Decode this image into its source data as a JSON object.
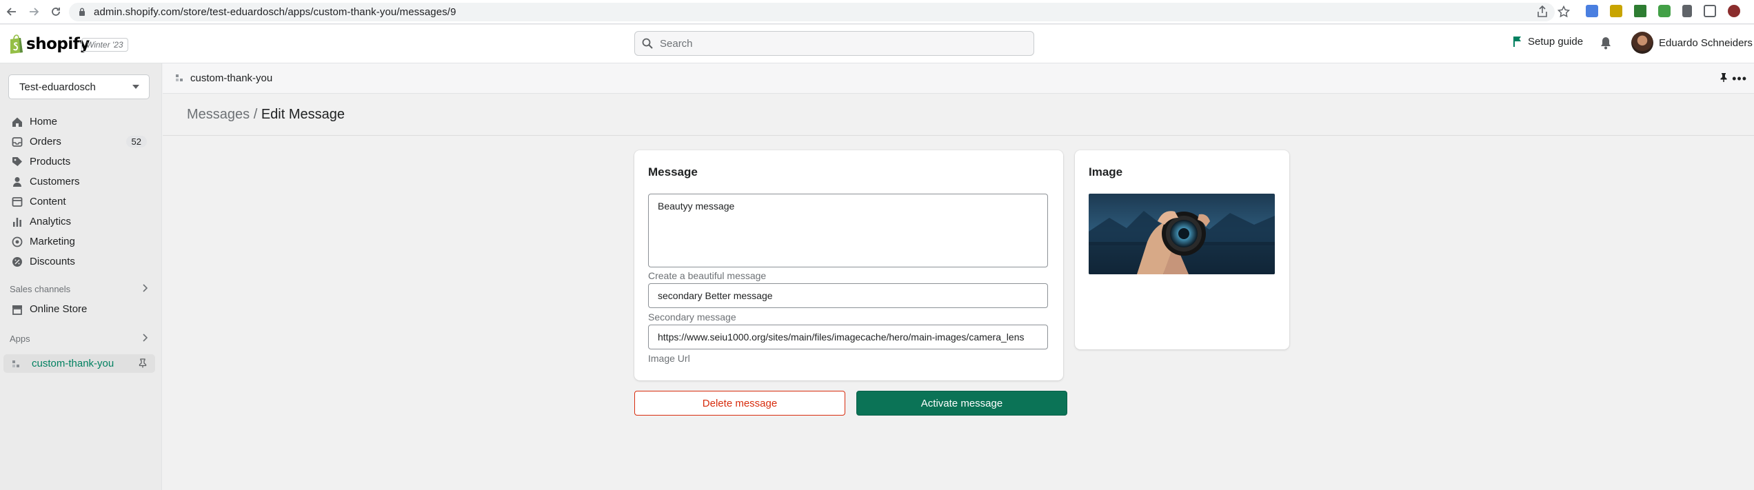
{
  "browser": {
    "url": "admin.shopify.com/store/test-eduardosch/apps/custom-thank-you/messages/9"
  },
  "topbar": {
    "brand": "shopify",
    "edition": "Winter '23",
    "search_placeholder": "Search",
    "setup_guide": "Setup guide",
    "user_name": "Eduardo Schneiders"
  },
  "sidebar": {
    "store_name": "Test-eduardosch",
    "items": [
      {
        "label": "Home",
        "icon": "home-icon"
      },
      {
        "label": "Orders",
        "icon": "orders-icon",
        "badge": "52"
      },
      {
        "label": "Products",
        "icon": "tag-icon"
      },
      {
        "label": "Customers",
        "icon": "person-icon"
      },
      {
        "label": "Content",
        "icon": "content-icon"
      },
      {
        "label": "Analytics",
        "icon": "bar-chart-icon"
      },
      {
        "label": "Marketing",
        "icon": "target-icon"
      },
      {
        "label": "Discounts",
        "icon": "discount-icon"
      }
    ],
    "sales_channels_title": "Sales channels",
    "online_store": "Online Store",
    "apps_title": "Apps",
    "app_item": "custom-thank-you"
  },
  "app_header": {
    "name": "custom-thank-you",
    "more": "•••"
  },
  "page": {
    "breadcrumb_parent": "Messages",
    "breadcrumb_sep": " / ",
    "breadcrumb_current": "Edit Message"
  },
  "message_card": {
    "title": "Message",
    "message_value": "Beautyy message",
    "message_help": "Create a beautiful message",
    "secondary_value": "secondary Better message",
    "secondary_help": "Secondary message",
    "image_url_value": "https://www.seiu1000.org/sites/main/files/imagecache/hero/main-images/camera_lens",
    "image_url_help": "Image Url"
  },
  "image_card": {
    "title": "Image"
  },
  "actions": {
    "delete": "Delete message",
    "activate": "Activate message"
  },
  "colors": {
    "primary": "#0b7356",
    "critical": "#d72c0d",
    "active_nav": "#008060"
  }
}
